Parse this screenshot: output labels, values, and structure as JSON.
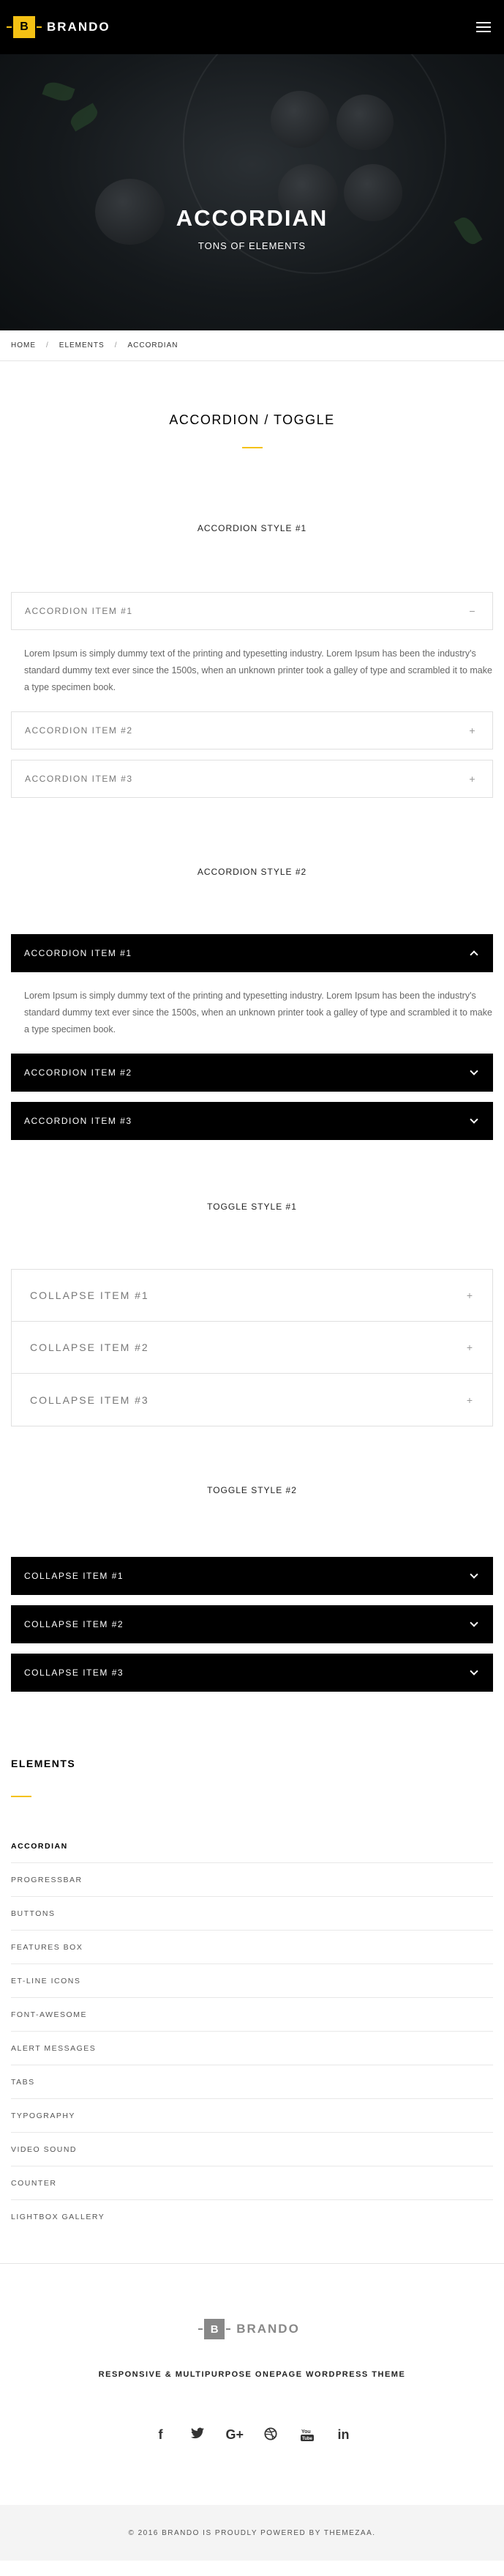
{
  "header": {
    "logo_letter": "B",
    "logo_text": "BRANDO",
    "menu_icon": "hamburger-icon"
  },
  "hero": {
    "title": "ACCORDIAN",
    "subtitle": "TONS OF ELEMENTS"
  },
  "breadcrumb": {
    "items": [
      "HOME",
      "ELEMENTS",
      "ACCORDIAN"
    ],
    "separator": "/"
  },
  "page": {
    "title": "ACCORDION / TOGGLE",
    "accent_color": "#f4c114"
  },
  "lorem": "Lorem Ipsum is simply dummy text of the printing and typesetting industry. Lorem Ipsum has been the industry's standard dummy text ever since the 1500s, when an unknown printer took a galley of type and scrambled it to make a type specimen book.",
  "style1": {
    "label": "ACCORDION STYLE #1",
    "items": [
      {
        "label": "ACCORDION ITEM #1",
        "sign": "−"
      },
      {
        "label": "ACCORDION ITEM #2",
        "sign": "+"
      },
      {
        "label": "ACCORDION ITEM #3",
        "sign": "+"
      }
    ]
  },
  "style2": {
    "label": "ACCORDION STYLE #2",
    "items": [
      {
        "label": "ACCORDION ITEM #1"
      },
      {
        "label": "ACCORDION ITEM #2"
      },
      {
        "label": "ACCORDION ITEM #3"
      }
    ]
  },
  "toggle1": {
    "label": "TOGGLE STYLE #1",
    "items": [
      {
        "label": "COLLAPSE ITEM #1",
        "sign": "+"
      },
      {
        "label": "COLLAPSE ITEM #2",
        "sign": "+"
      },
      {
        "label": "COLLAPSE ITEM #3",
        "sign": "+"
      }
    ]
  },
  "toggle2": {
    "label": "TOGGLE STYLE #2",
    "items": [
      {
        "label": "COLLAPSE ITEM #1"
      },
      {
        "label": "COLLAPSE ITEM #2"
      },
      {
        "label": "COLLAPSE ITEM #3"
      }
    ]
  },
  "elements": {
    "title": "ELEMENTS",
    "items": [
      "ACCORDIAN",
      "PROGRESSBAR",
      "BUTTONS",
      "FEATURES BOX",
      "ET-LINE ICONS",
      "FONT-AWESOME",
      "ALERT MESSAGES",
      "TABS",
      "TYPOGRAPHY",
      "VIDEO SOUND",
      "COUNTER",
      "LIGHTBOX GALLERY"
    ]
  },
  "footer": {
    "logo_letter": "B",
    "logo_text": "BRANDO",
    "tagline": "RESPONSIVE & MULTIPURPOSE ONEPAGE WORDPRESS THEME",
    "social": [
      {
        "icon": "facebook-icon",
        "glyph": "f"
      },
      {
        "icon": "twitter-icon",
        "glyph": "🐦"
      },
      {
        "icon": "google-plus-icon",
        "glyph": "G+"
      },
      {
        "icon": "dribbble-icon",
        "glyph": "◎"
      },
      {
        "icon": "youtube-icon",
        "glyph": "▶"
      },
      {
        "icon": "linkedin-icon",
        "glyph": "in"
      }
    ],
    "copyright": "© 2016 BRANDO IS PROUDLY POWERED BY THEMEZAA."
  }
}
